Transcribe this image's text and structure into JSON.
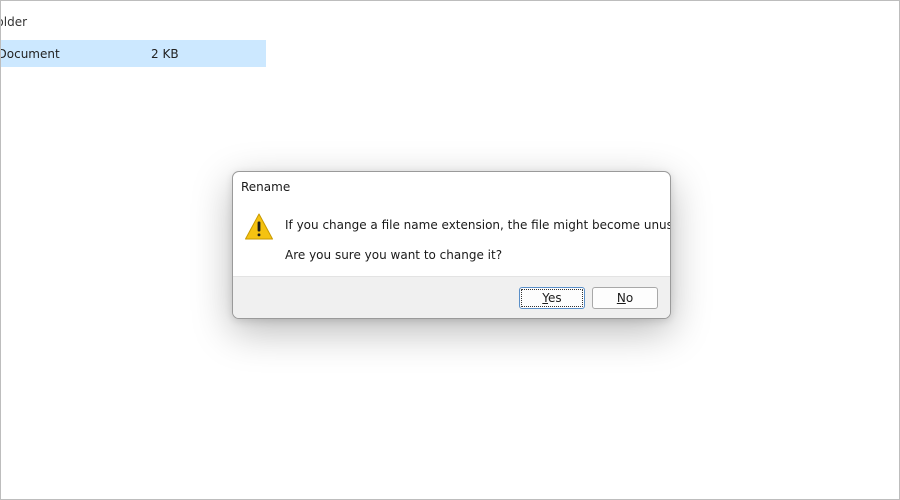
{
  "explorer": {
    "folder_label": "e folder",
    "file_type": "t Document",
    "file_size": "2 KB"
  },
  "dialog": {
    "title": "Rename",
    "message": "If you change a file name extension, the file might become unusable.",
    "question": "Are you sure you want to change it?",
    "buttons": {
      "yes_label": "Yes",
      "no_label": "No"
    },
    "icon": "warning-icon"
  },
  "colors": {
    "selection": "#cce8ff",
    "warning_yellow": "#f5c211",
    "footer": "#f0f0f0",
    "default_button_border": "#5a8fc8"
  }
}
